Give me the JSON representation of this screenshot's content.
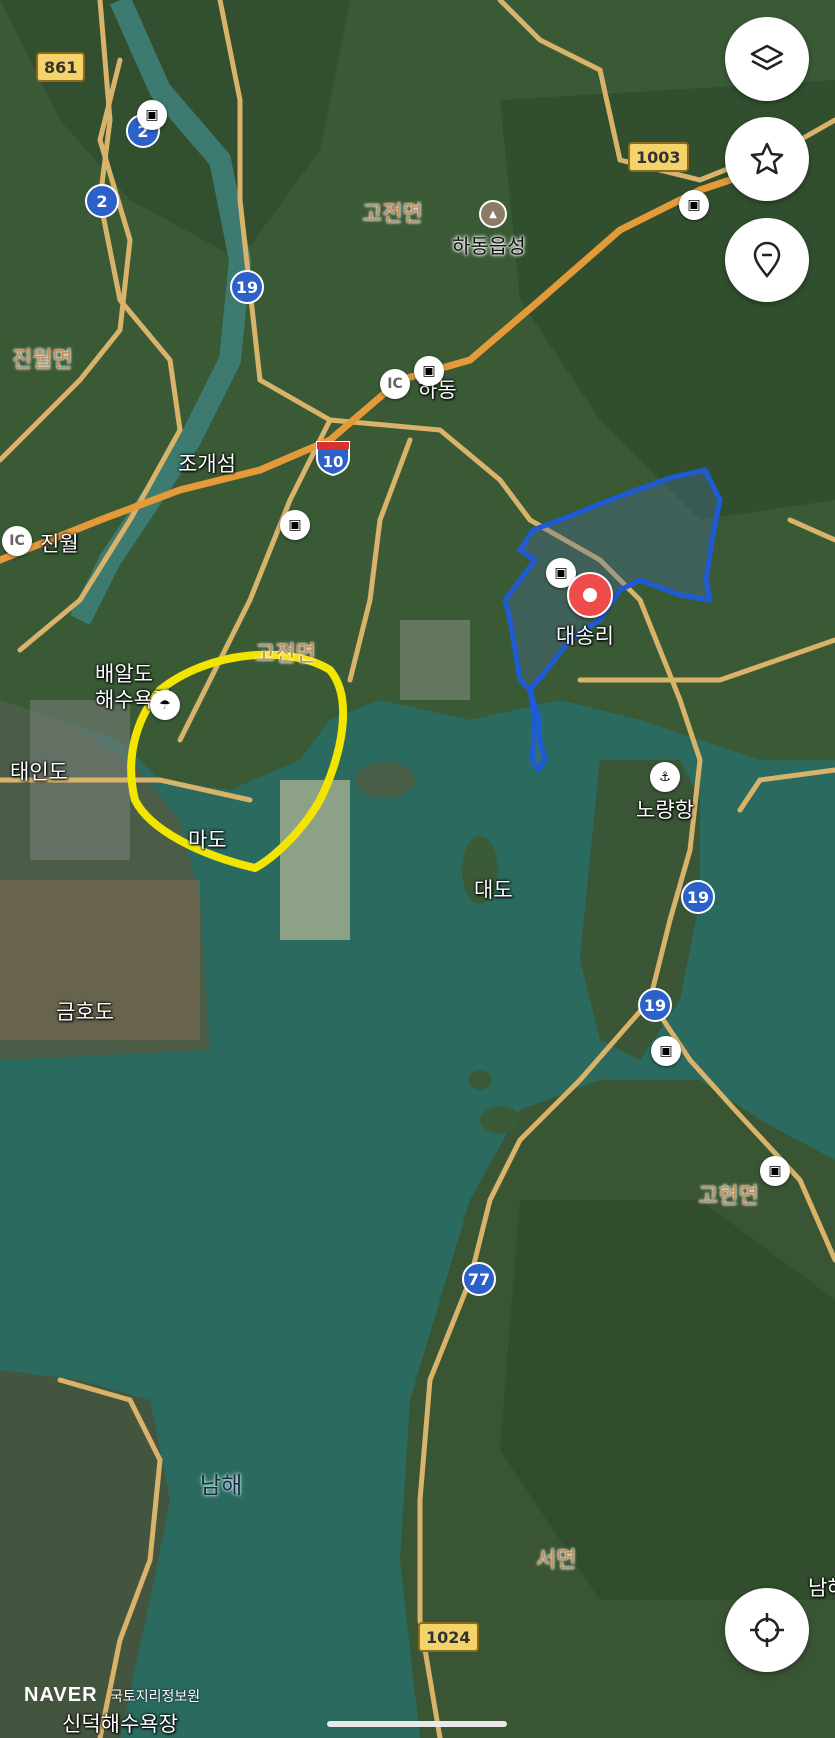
{
  "map": {
    "provider": "NAVER",
    "credit": "국토지리정보원",
    "layer": "satellite"
  },
  "labels": {
    "region_gojeon": "고전면",
    "region_jinwol": "진월면",
    "region_goseong": "고전면",
    "region_gohyeon": "고현면",
    "region_seomyeon": "서면",
    "poi_hadong_eupseong": "하동읍성",
    "poi_hadong": "하동",
    "poi_jogaeseom": "조개섬",
    "poi_jinwol": "진월",
    "poi_baealdo": "배알도",
    "poi_baealdo2": "해수욕장",
    "poi_taeindo": "태인도",
    "poi_mado": "마도",
    "poi_daesongri": "대송리",
    "poi_noryang": "노량항",
    "poi_daedo": "대도",
    "poi_geumhodo": "금호도",
    "poi_namhae": "남해",
    "poi_sindeok": "신덕해수욕장",
    "poi_nam_edge": "남해"
  },
  "road_shields": {
    "r861": "861",
    "r2a": "2",
    "r2b": "2",
    "r19a": "19",
    "r19b": "19",
    "r19c": "19",
    "r10": "10",
    "r1003": "1003",
    "r77": "77",
    "r1024": "1024"
  },
  "ic_badge": "IC",
  "controls": {
    "layers": "layers-icon",
    "favorite": "star-icon",
    "location_pin": "location-pin-icon",
    "current_location": "crosshair-icon"
  },
  "colors": {
    "water": "#2b6a5e",
    "land": "#3c5a3a",
    "road": "#d9b36a",
    "highway": "#e59a3a",
    "outline_blue": "#1e5bd6",
    "circle_yellow": "#f2e600",
    "pin": "#ef4b4b"
  }
}
